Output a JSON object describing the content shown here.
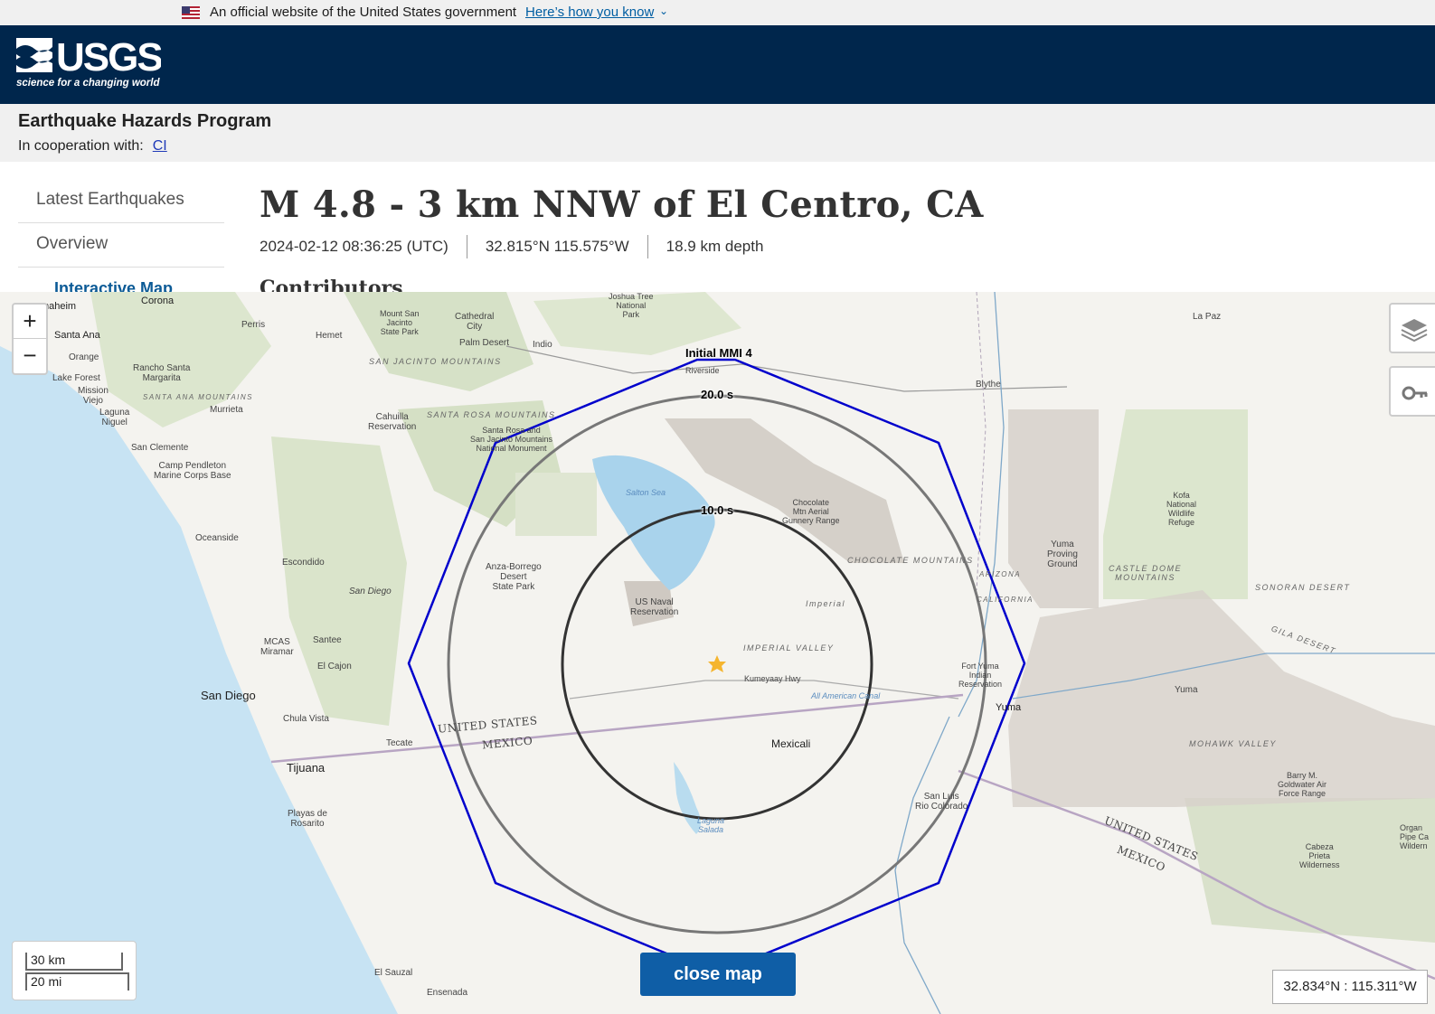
{
  "gov_banner": {
    "text": "An official website of the United States government",
    "link": "Here’s how you know"
  },
  "header": {
    "logo_text": "USGS",
    "logo_tagline": "science for a changing world"
  },
  "program": {
    "title": "Earthquake Hazards Program",
    "coop_label": "In cooperation with:",
    "coop_link": "CI"
  },
  "nav": {
    "items": [
      {
        "label": "Latest Earthquakes"
      },
      {
        "label": "Overview"
      },
      {
        "label": "Interactive Map"
      }
    ]
  },
  "event": {
    "title": "M 4.8 - 3 km NNW of El Centro, CA",
    "time": "2024-02-12 08:36:25 (UTC)",
    "location": "32.815°N 115.575°W",
    "depth": "18.9 km depth",
    "section": "Contributors"
  },
  "map": {
    "zoom_in": "+",
    "zoom_out": "−",
    "layers_icon": "layers-icon",
    "legend_icon": "key-icon",
    "ring_labels": {
      "mmi": "Initial MMI 4",
      "outer": "20.0 s",
      "inner": "10.0 s"
    },
    "scale_km": "30 km",
    "scale_mi": "20 mi",
    "close_label": "close map",
    "coordinates": "32.834°N : 115.311°W",
    "colors": {
      "mmi": "#0000cc",
      "ring_outer": "#777777",
      "ring_inner": "#333333",
      "epicenter": "#f5b52e"
    },
    "places": {
      "anaheim": "naheim",
      "corona": "Corona",
      "santa_ana": "Santa Ana",
      "orange": "Orange",
      "lake_forest": "Lake Forest",
      "mission_viejo": "Mission\nViejo",
      "laguna_niguel": "Laguna\nNiguel",
      "san_clemente": "San Clemente",
      "camp_pendleton": "Camp Pendleton\nMarine Corps Base",
      "oceanside": "Oceanside",
      "escondido": "Escondido",
      "san_diego": "San Diego",
      "san_diego_small": "San Diego",
      "santee": "Santee",
      "el_cajon": "El Cajon",
      "mcas": "MCAS\nMiramar",
      "chula_vista": "Chula Vista",
      "tijuana": "Tijuana",
      "playas": "Playas de\nRosarito",
      "tecate": "Tecate",
      "el_sauzal": "El Sauzal",
      "ensenada": "Ensenada",
      "perris": "Perris",
      "hemet": "Hemet",
      "murrieta": "Murrieta",
      "rancho": "Rancho Santa\nMargarita",
      "cathedral": "Cathedral\nCity",
      "palm_desert": "Palm Desert",
      "indio": "Indio",
      "joshua_tree": "Joshua Tree\nNational\nPark",
      "mt_san_jacinto": "Mount San\nJacinto\nState Park",
      "cahuilla": "Cahuilla\nReservation",
      "santa_rosa_mon": "Santa Rosa and\nSan Jacinto Mountains\nNational Monument",
      "anza": "Anza-Borrego\nDesert\nState Park",
      "salton_sea": "Salton Sea",
      "us_naval": "US Naval\nReservation",
      "chocolate_range": "Chocolate\nMtn Aerial\nGunnery Range",
      "imperial": "Imperial",
      "imperial_valley": "IMPERIAL VALLEY",
      "mexicali": "Mexicali",
      "kumeyaay": "Kumeyaay Hwy",
      "all_american": "All American Canal",
      "blythe": "Blythe",
      "la_paz": "La Paz",
      "riverside": "Riverside",
      "yuma_proving": "Yuma\nProving\nGround",
      "kofa": "Kofa\nNational\nWildlife\nRefuge",
      "castle_dome": "CASTLE DOME\nMOUNTAINS",
      "sonoran": "SONORAN DESERT",
      "fort_yuma": "Fort Yuma\nIndian\nReservation",
      "yuma": "Yuma",
      "yuma2": "Yuma",
      "san_luis": "San Luis\nRio Colorado",
      "mohawk": "MOHAWK VALLEY",
      "barry": "Barry M.\nGoldwater Air\nForce Range",
      "cabeza": "Cabeza\nPrieta\nWilderness",
      "laguna_salada": "Laguna\nSalada",
      "us_left": "UNITED STATES",
      "mx_left": "MEXICO",
      "us_right": "UNITED STATES",
      "mx_right": "MEXICO",
      "san_jacinto_mtns": "SAN JACINTO MOUNTAINS",
      "santa_rosa_mtns": "SANTA ROSA MOUNTAINS",
      "santa_ana_mtns": "SANTA ANA MOUNTAINS",
      "chocolate_mtns": "CHOCOLATE MOUNTAINS",
      "arizona": "ARIZONA",
      "california": "CALIFORNIA",
      "gila": "GILA DESERT",
      "organ": "Organ\nPipe Ca\nWildern"
    }
  }
}
